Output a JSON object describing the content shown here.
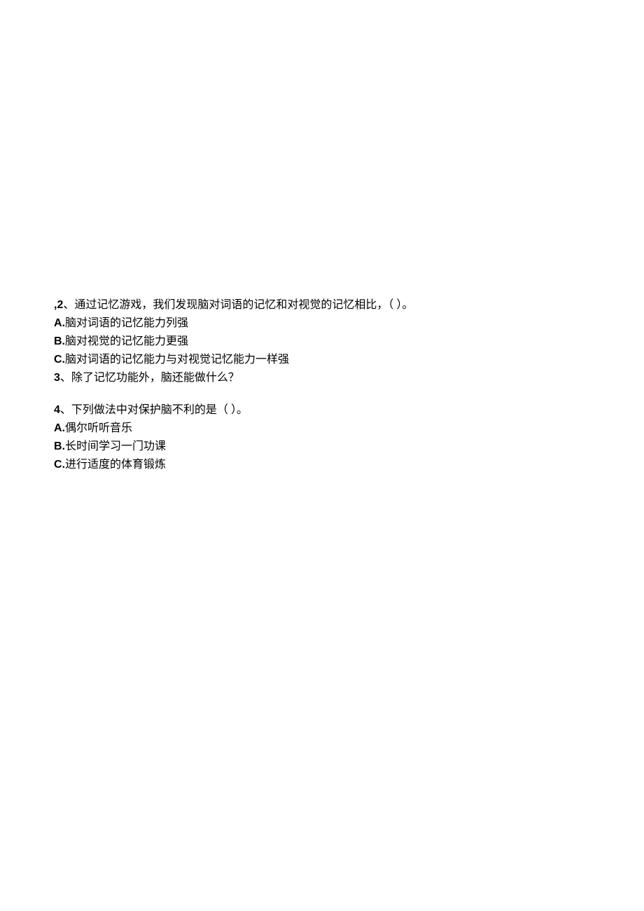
{
  "q2": {
    "number": ",2",
    "sep": "、",
    "stem_a": "通过记忆游戏，我们发现脑对词语的记忆和对视觉的记忆相比，（",
    "blank": "          ",
    "stem_b": "）。",
    "optA_label": "A.",
    "optA_text": "脑对词语的记忆能力列强",
    "optB_label": "B.",
    "optB_text": "脑对视觉的记忆能力更强",
    "optC_label": "C.",
    "optC_text": "脑对词语的记忆能力与对视觉记忆能力一样强"
  },
  "q3": {
    "number": "3",
    "sep": "、",
    "stem": "除了记忆功能外，脑还能做什么？"
  },
  "q4": {
    "number": "4",
    "sep": "、",
    "stem_a": "下列做法中对保护脑不利的是（",
    "blank": "      ",
    "stem_b": "）。",
    "optA_label": "A.",
    "optA_text": "偶尔听听音乐",
    "optB_label": "B.",
    "optB_text": "长时间学习一门功课",
    "optC_label": "C.",
    "optC_text": "进行适度的体育锻炼"
  }
}
